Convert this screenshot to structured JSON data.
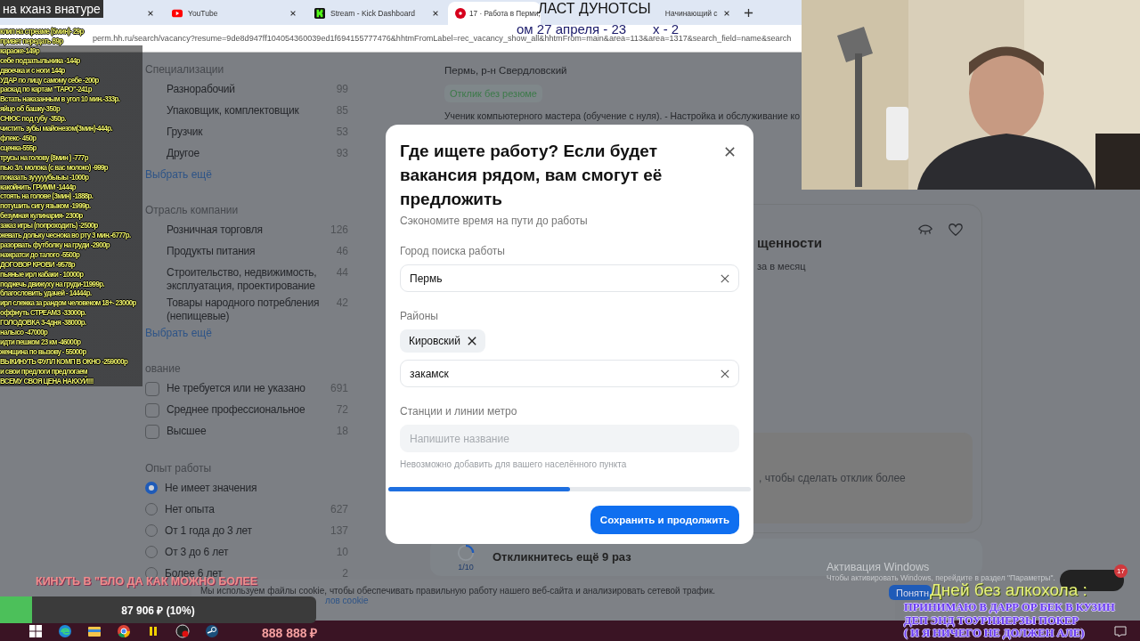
{
  "browser": {
    "tabs": [
      {
        "selected": false
      },
      {
        "title": "YouTube",
        "selected": false
      },
      {
        "title": "Stream - Kick Dashboard",
        "selected": false
      },
      {
        "title": "17 · Работа в Перми,",
        "selected": true
      },
      {
        "title": "Начинающий с",
        "selected": false
      }
    ],
    "url": "perm.hh.ru/search/vacancy?resume=9de8d947ff104054360039ed1f694155777476&hhtmFromLabel=rec_vacancy_show_all&hhtmFrom=main&area=113&area=1317&search_field=name&search"
  },
  "sidebar": [
    {
      "title": "Специализации",
      "more": "Выбрать ещё",
      "items": [
        {
          "kind": "plain",
          "label": "Разнорабочий",
          "count": "99"
        },
        {
          "kind": "plain",
          "label": "Упаковщик, комплектовщик",
          "count": "85"
        },
        {
          "kind": "plain",
          "label": "Грузчик",
          "count": "53"
        },
        {
          "kind": "plain",
          "label": "Другое",
          "count": "93"
        }
      ]
    },
    {
      "title": "Отрасль компании",
      "more": "Выбрать ещё",
      "items": [
        {
          "kind": "plain",
          "label": "Розничная торговля",
          "count": "126"
        },
        {
          "kind": "plain",
          "label": "Продукты питания",
          "count": "46"
        },
        {
          "kind": "plain",
          "label": "Строительство, недвижимость, эксплуатация, проектирование",
          "count": "44"
        },
        {
          "kind": "plain",
          "label": "Товары народного потребления (непищевые)",
          "count": "42"
        }
      ]
    },
    {
      "title": "ование",
      "items": [
        {
          "kind": "checkbox",
          "label": "Не требуется или не указано",
          "count": "691",
          "checked": false
        },
        {
          "kind": "checkbox",
          "label": "Среднее профессиональное",
          "count": "72",
          "checked": false
        },
        {
          "kind": "checkbox",
          "label": "Высшее",
          "count": "18",
          "checked": false
        }
      ]
    },
    {
      "title": "Опыт работы",
      "items": [
        {
          "kind": "radio",
          "label": "Не имеет значения",
          "selected": true
        },
        {
          "kind": "radio",
          "label": "Нет опыта",
          "count": "627",
          "selected": false
        },
        {
          "kind": "radio",
          "label": "От 1 года до 3 лет",
          "count": "137",
          "selected": false
        },
        {
          "kind": "radio",
          "label": "От 3 до 6 лет",
          "count": "10",
          "selected": false
        },
        {
          "kind": "radio",
          "label": "Более 6 лет",
          "count": "2",
          "selected": false
        }
      ]
    }
  ],
  "vacancy": {
    "location": "Пермь, р-н Свердловский",
    "badge": "Отклик без резюме",
    "description": "Ученик компьютерного мастера (обучение с нуля). - Настройка и обслуживание ко"
  },
  "card": {
    "title": "щенности",
    "meta": "за в месяц",
    "note": ", чтобы сделать отклик более"
  },
  "progress_card": {
    "title": "Откликнитесь ещё 9 раз",
    "counter": "1/10"
  },
  "cookie": {
    "text": "Мы используем файлы cookie, чтобы обеспечивать правильную работу нашего веб-сайта и анализировать сетевой трафик.",
    "link": "лов cookie",
    "button": "Понятн"
  },
  "activation": {
    "title": "Активация Windows",
    "text": "Чтобы активировать Windows, перейдите в раздел \"Параметры\"."
  },
  "chats": {
    "badge": "17"
  },
  "modal": {
    "title": "Где ищете работу? Если будет вакансия рядом, вам смогут её предложить",
    "subtitle": "Сэкономите время на пути до работы",
    "city": {
      "label": "Город поиска работы",
      "value": "Пермь"
    },
    "districts": {
      "label": "Районы",
      "chips": [
        "Кировский"
      ],
      "value": "закамск"
    },
    "metro": {
      "label": "Станции и линии метро",
      "placeholder": "Напишите название",
      "disabled": true,
      "hint": "Невозможно добавить для вашего населённого пункта"
    },
    "progress": {
      "level": 0.5
    },
    "button": "Сохранить и продолжить"
  },
  "overlay": {
    "chat_title": "на кханз внатуре",
    "price_list": [
      "клип на стреаме (5мин)- 29р",
      "привет передать 89р",
      "караоке-149р",
      "себе подзатыльника -144р",
      "двоечка и с ноги 144р",
      "УДАР по лицу самому себе -200р",
      "раскад по картам \"ТАРО\"-241р",
      "Встать наказанным в угол 10 мин.-333р.",
      "яйцо об башку-350р",
      "СНЮС под губу -350р.",
      "чистить зубы майонезом(3мин)-444р.",
      "флекс- 450р",
      "сценка-555р",
      "трусы на голову (8мин ) -777р",
      "пью 3л. молока (с вас молоко) -999р",
      "показать зууууубыыы -1000р",
      "какойнить ГРИММ -1444р",
      "стоять на голове (3мин) -1888р.",
      "потушить сигу языком -1999р.",
      "безумная кулинария- 2300р",
      "заказ игры (попроходить) -2500р",
      "жевать дольку чеснока во рту 3 мин.-6777р.",
      "разорвать футболку на груди -2900р",
      "нажратси до талого -5500р",
      "ДОГОВОР КРОВИ -9578р",
      "пьяные ирл кабаки - 10000р",
      "поджечь движуху на груди-11999р.",
      "благословить удачей - 14444р.",
      "ирл слежка за рандом человеком 18+- 23000р",
      "оффнуть СТРЕАМЗ -33000р.",
      "ГОЛОДОВКА 3-4дня -38000р.",
      "налысо -47000р",
      "идти пешком 23 км -46000р",
      "женщина по вызову - 55000р",
      "ВЫКИНУТЬ ФУЛЛ КОМП В ОКНО -259000р",
      "и свои предлоги предлогаем",
      "ВСЕМУ СВОЯ ЦЕНА НАКХУЙ!!!"
    ],
    "headline": "ЛАСТ ДУНОТСЫ",
    "date": "ом 27 апреля - 23",
    "date_tail": "х - 2",
    "marquee": "КИНУТЬ В \"БЛО ДА КАК МОЖНО БОЛЕЕ",
    "goal": {
      "text": "87 906 ₽ (10%)",
      "level": 0.1
    },
    "counter": "888 888 ₽",
    "sober": "Дней без алкохола :",
    "notice": [
      "ПРИНИМАЮ В ДАРР ОР БЕК В КУЗИН",
      "ДЕП ЭНД ТОУРНИЕРЗЫ ПОКЕР",
      "( И Я НИЧЕГО НЕ ДОЛЖЕН АЛЕ)"
    ]
  }
}
